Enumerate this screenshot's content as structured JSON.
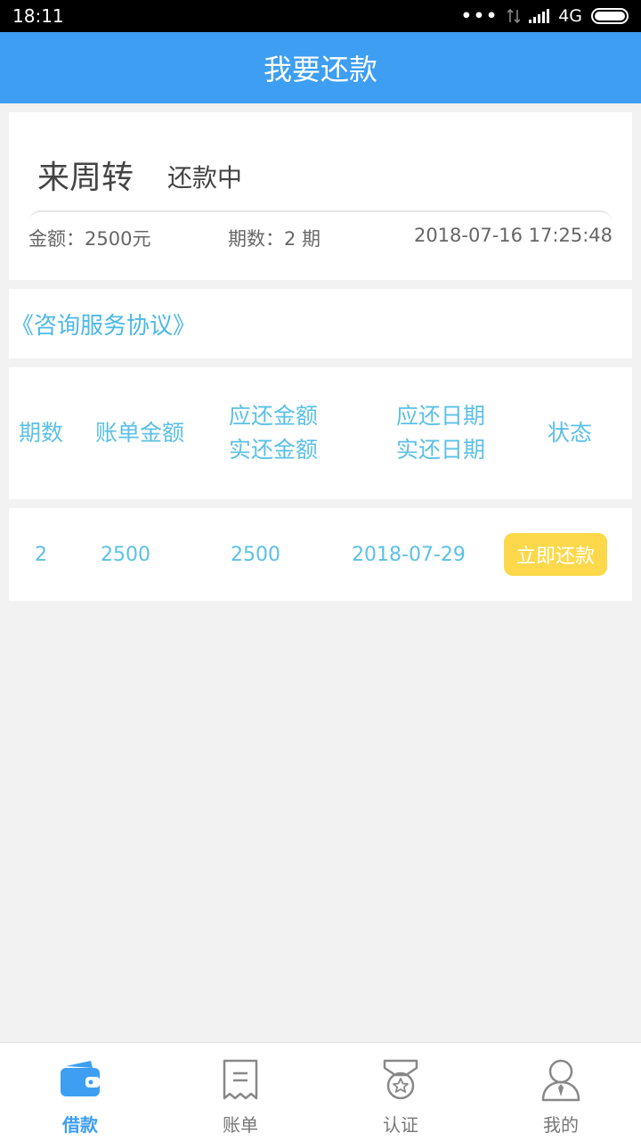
{
  "status_bar": {
    "time": "18:11",
    "dots": "•••",
    "network": "4G"
  },
  "header": {
    "title": "我要还款"
  },
  "loan": {
    "name": "来周转",
    "status": "还款中",
    "amount_text": "金额：2500元",
    "periods_text": "期数：2 期",
    "datetime": "2018-07-16 17:25:48"
  },
  "agreement": {
    "link": "《咨询服务协议》"
  },
  "table": {
    "headers": {
      "period": "期数",
      "bill_amount": "账单金额",
      "due_amount": "应还金额",
      "paid_amount": "实还金额",
      "due_date": "应还日期",
      "paid_date": "实还日期",
      "status": "状态"
    },
    "rows": [
      {
        "period": "2",
        "bill_amount": "2500",
        "due_amount": "2500",
        "due_date": "2018-07-29",
        "action": "立即还款"
      }
    ]
  },
  "tabbar": {
    "items": [
      {
        "label": "借款",
        "icon": "wallet-icon",
        "active": true
      },
      {
        "label": "账单",
        "icon": "receipt-icon",
        "active": false
      },
      {
        "label": "认证",
        "icon": "badge-icon",
        "active": false
      },
      {
        "label": "我的",
        "icon": "user-icon",
        "active": false
      }
    ]
  },
  "colors": {
    "primary": "#3d9ef2",
    "table_text": "#5bc0e6",
    "button": "#fcd84a",
    "background": "#f2f2f2"
  }
}
